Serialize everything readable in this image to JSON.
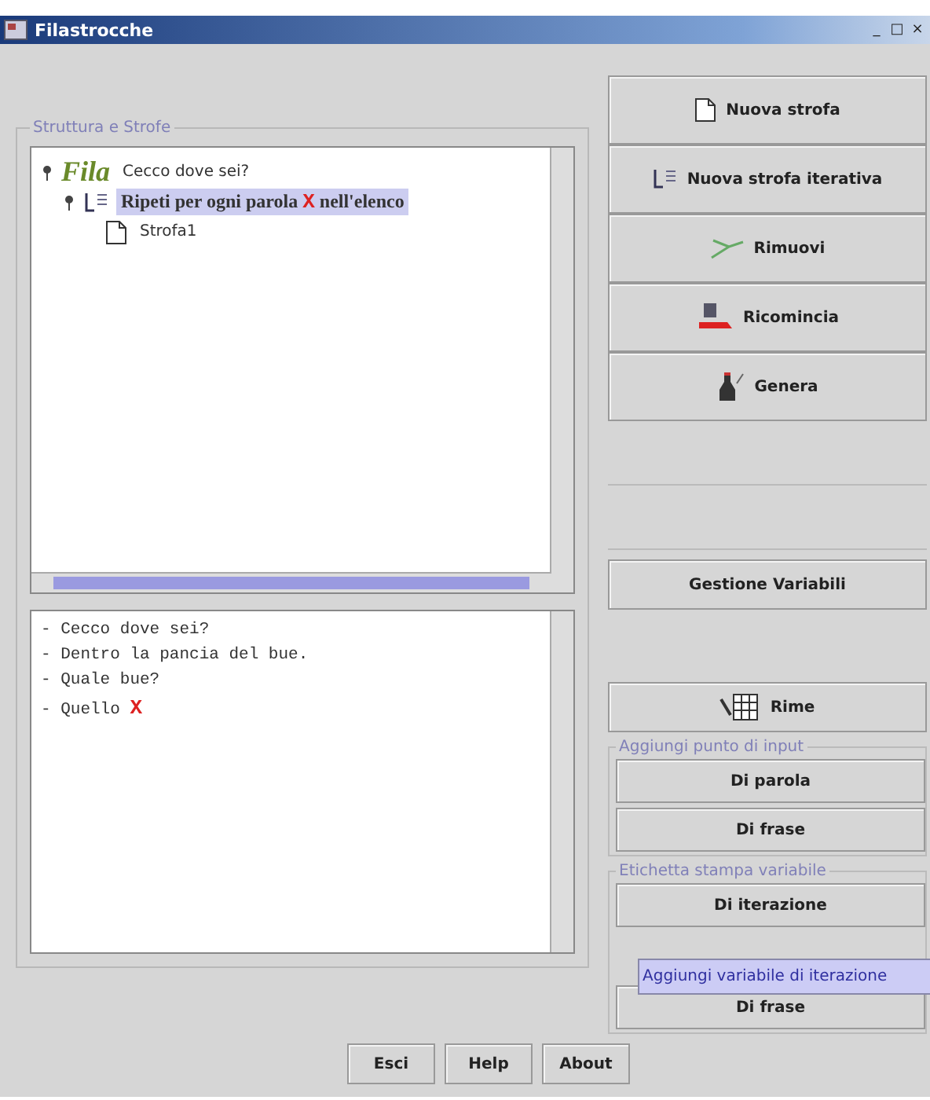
{
  "window": {
    "title": "Filastrocche",
    "controls": [
      "_",
      "□",
      "×"
    ]
  },
  "structure": {
    "title": "Struttura e Strofe",
    "tree": [
      {
        "logo": "Fila",
        "label": "Cecco dove sei?",
        "selected": false,
        "expanded": true,
        "kind": "poem",
        "children": [
          {
            "parts": [
              {
                "text": "Ripeti per ogni parola ",
                "variable": false
              },
              {
                "text": "X",
                "variable": true
              },
              {
                "text": " nell'elenco",
                "variable": false
              }
            ],
            "selected": true,
            "expanded": true,
            "kind": "loop",
            "children": [
              {
                "label": "Strofa1",
                "selected": false,
                "kind": "stanza"
              }
            ]
          }
        ]
      }
    ]
  },
  "text_area": {
    "lines": [
      [
        {
          "text": "- Cecco dove sei?",
          "variable": false
        }
      ],
      [
        {
          "text": "- Dentro la pancia del bue.",
          "variable": false
        }
      ],
      [
        {
          "text": "- Quale bue?",
          "variable": false
        }
      ],
      [
        {
          "text": "- Quello ",
          "variable": false
        },
        {
          "text": "X",
          "variable": true
        }
      ]
    ]
  },
  "actions": [
    {
      "label": "Nuova strofa",
      "kind": "page"
    },
    {
      "label": "Nuova strofa iterativa",
      "kind": "loop"
    },
    {
      "label": "Rimuovi",
      "kind": "scissors"
    },
    {
      "label": "Ricomincia",
      "kind": "eraser"
    },
    {
      "label": "Genera",
      "kind": "bottle"
    }
  ],
  "variables_button": "Gestione Variabili",
  "rhymes_button": "Rime",
  "input_group": {
    "title": "Aggiungi punto di input",
    "buttons": [
      "Di parola",
      "Di frase"
    ]
  },
  "print_group": {
    "title": "Etichetta stampa variabile",
    "buttons": [
      "Di iterazione",
      "Di frase"
    ]
  },
  "tooltip": "Aggiungi variabile di iterazione",
  "footer_buttons": [
    "Esci",
    "Help",
    "About"
  ]
}
